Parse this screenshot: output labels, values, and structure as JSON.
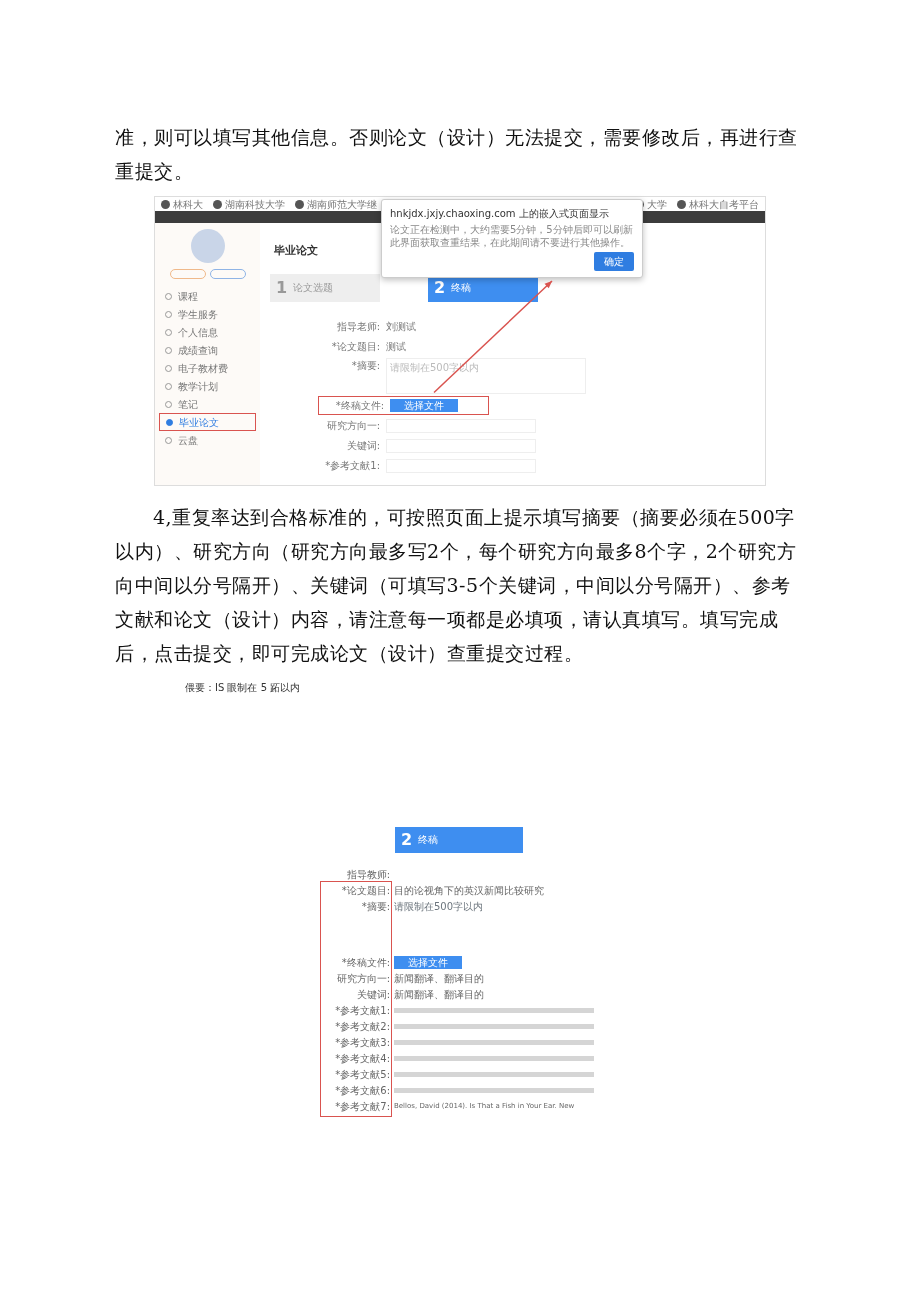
{
  "paragraphs": [
    {
      "text": "准，则可以填写其他信息。否则论文（设计）无法提交，需要修改后，再进行查重提交。",
      "indent": false
    },
    {
      "text": "4,重复率达到合格标准的，可按照页面上提示填写摘要（摘要必须在500字以内）、研究方向（研究方向最多写2个，每个研究方向最多8个字，2个研究方向中间以分号隔开）、关键词（可填写3-5个关键词，中间以分号隔开）、参考文献和论文（设计）内容，请注意每一项都是必填项，请认真填写。填写完成后，点击提交，即可完成论文（设计）查重提交过程。",
      "indent": true
    }
  ],
  "screenshot_1": {
    "bookmarks": [
      "林科大",
      "湖南科技大学",
      "湖南师范大学继",
      "大学",
      "林科大自考平台"
    ],
    "sidebar": [
      {
        "label": "课程",
        "selected": false
      },
      {
        "label": "学生服务",
        "selected": false
      },
      {
        "label": "个人信息",
        "selected": false
      },
      {
        "label": "成绩查询",
        "selected": false
      },
      {
        "label": "电子教材费",
        "selected": false
      },
      {
        "label": "教学计划",
        "selected": false
      },
      {
        "label": "笔记",
        "selected": false
      },
      {
        "label": "毕业论文",
        "selected": true
      },
      {
        "label": "云盘",
        "selected": false
      }
    ],
    "page_title": "毕业论文",
    "steps": [
      {
        "number": "1",
        "title": "论文选题",
        "selected": false
      },
      {
        "number": "2",
        "title": "终稿",
        "selected": true
      }
    ],
    "form": [
      {
        "label": "指导老师:",
        "value": "刘测试",
        "kind": "text"
      },
      {
        "label": "*论文题目:",
        "value": "测试",
        "kind": "text"
      },
      {
        "label": "*摘要:",
        "placeholder": "请限制在500字以内",
        "kind": "textarea"
      },
      {
        "label": "*终稿文件:",
        "button": "选择文件",
        "kind": "file",
        "highlighted": true
      },
      {
        "label": "研究方向一:",
        "kind": "input"
      },
      {
        "label": "关键词:",
        "kind": "input"
      },
      {
        "label": "*参考文献1:",
        "kind": "input"
      }
    ],
    "dialog": {
      "title": "hnkjdx.jxjy.chaoxing.com 上的嵌入式页面显示",
      "message": "论文正在检测中，大约需要5分钟，5分钟后即可以刷新此界面获取查重结果，在此期间请不要进行其他操作。",
      "button": "确定"
    }
  },
  "caption": "偎要：IS 眼制在 5 跖以内",
  "screenshot_2": {
    "step": {
      "number": "2",
      "title": "终稿"
    },
    "highlight_labels": true,
    "form": [
      {
        "label": "指导教师:",
        "kind": "text"
      },
      {
        "label": "*论文题目:",
        "value": "目的论视角下的英汉新闻比较研究",
        "kind": "text"
      },
      {
        "label": "*摘要:",
        "placeholder": "请限制在500字以内",
        "kind": "textarea"
      },
      {
        "label": "*终稿文件:",
        "button": "选择文件",
        "kind": "file"
      },
      {
        "label": "研究方向一:",
        "value": "新闻翻译、翻译目的",
        "kind": "input"
      },
      {
        "label": "关键词:",
        "value": "新闻翻译、翻译目的",
        "kind": "input"
      },
      {
        "label": "*参考文献1:",
        "kind": "blurred"
      },
      {
        "label": "*参考文献2:",
        "kind": "blurred"
      },
      {
        "label": "*参考文献3:",
        "kind": "blurred"
      },
      {
        "label": "*参考文献4:",
        "kind": "blurred"
      },
      {
        "label": "*参考文献5:",
        "kind": "blurred"
      },
      {
        "label": "*参考文献6:",
        "kind": "blurred"
      },
      {
        "label": "*参考文献7:",
        "value": "Bellos, David (2014). Is That a Fish in Your Ear. New",
        "kind": "input"
      }
    ]
  }
}
